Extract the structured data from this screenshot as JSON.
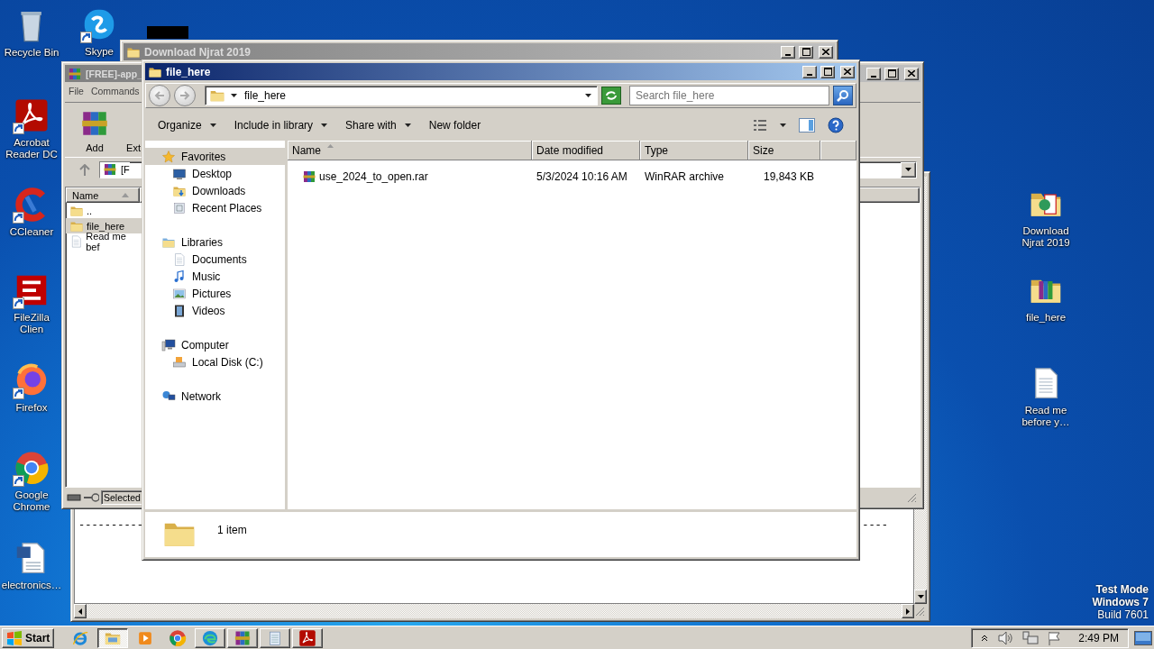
{
  "desktop_icons": [
    {
      "label": "Recycle Bin",
      "kind": "recycle",
      "shortcut": false
    },
    {
      "label": "Skype",
      "kind": "skype",
      "shortcut": true
    },
    {
      "label": "Acrobat Reader DC",
      "kind": "acrobat",
      "shortcut": true
    },
    {
      "label": "CCleaner",
      "kind": "ccleaner",
      "shortcut": true
    },
    {
      "label": "FileZilla Clien",
      "kind": "filezilla",
      "shortcut": true
    },
    {
      "label": "Firefox",
      "kind": "firefox",
      "shortcut": true
    },
    {
      "label": "Google Chrome",
      "kind": "chrome",
      "shortcut": true
    },
    {
      "label": "electronics…",
      "kind": "word",
      "shortcut": false
    },
    {
      "label": "Download Njrat 2019",
      "kind": "njfolder",
      "shortcut": false
    },
    {
      "label": "file_here",
      "kind": "rarfolder",
      "shortcut": false
    },
    {
      "label": "Read me before y…",
      "kind": "text",
      "shortcut": false
    }
  ],
  "text_window": {
    "lines": [
      "----------",
      "----"
    ]
  },
  "njrat_window": {
    "title": "Download Njrat 2019",
    "active": false
  },
  "winrar_window": {
    "title": "[FREE]-app_",
    "active": false,
    "menu": [
      "File",
      "Commands"
    ],
    "tools": [
      {
        "label": "Add",
        "kind": "archive"
      },
      {
        "label": "Ext",
        "kind": "none"
      }
    ],
    "path": "[F",
    "column": "Name",
    "files": [
      {
        "name": "..",
        "kind": "folder",
        "selected": false
      },
      {
        "name": "file_here",
        "kind": "folder",
        "selected": true
      },
      {
        "name": "Read me bef",
        "kind": "text",
        "selected": false
      }
    ],
    "status": "Selected"
  },
  "explorer_window": {
    "title": "file_here",
    "active": true,
    "breadcrumb": "file_here",
    "search": {
      "placeholder": "Search file_here"
    },
    "commands": [
      {
        "label": "Organize",
        "dropdown": true
      },
      {
        "label": "Include in library",
        "dropdown": true
      },
      {
        "label": "Share with",
        "dropdown": true
      },
      {
        "label": "New folder",
        "dropdown": false
      }
    ],
    "nav": [
      {
        "label": "Favorites",
        "kind": "star",
        "selected": true,
        "children": [
          {
            "label": "Desktop",
            "kind": "desktop",
            "selected": false
          },
          {
            "label": "Downloads",
            "kind": "downloads",
            "selected": false
          },
          {
            "label": "Recent Places",
            "kind": "recent",
            "selected": false
          }
        ]
      },
      {
        "label": "Libraries",
        "kind": "library",
        "selected": false,
        "children": [
          {
            "label": "Documents",
            "kind": "documents",
            "selected": false
          },
          {
            "label": "Music",
            "kind": "music",
            "selected": false
          },
          {
            "label": "Pictures",
            "kind": "pictures",
            "selected": false
          },
          {
            "label": "Videos",
            "kind": "videos",
            "selected": false
          }
        ]
      },
      {
        "label": "Computer",
        "kind": "computer",
        "selected": false,
        "children": [
          {
            "label": "Local Disk (C:)",
            "kind": "disk",
            "selected": false
          }
        ]
      },
      {
        "label": "Network",
        "kind": "network",
        "selected": false
      }
    ],
    "columns": [
      {
        "label": "Name",
        "sorted": true
      },
      {
        "label": "Date modified",
        "sorted": false
      },
      {
        "label": "Type",
        "sorted": false
      },
      {
        "label": "Size",
        "sorted": false
      }
    ],
    "files": [
      {
        "name": "use_2024_to_open.rar",
        "kind": "rar",
        "date": "5/3/2024 10:16 AM",
        "type": "WinRAR archive",
        "size": "19,843 KB",
        "selected": false
      }
    ],
    "details": "1 item"
  },
  "taskbar": {
    "start": "Start",
    "apps": [
      {
        "kind": "ie",
        "running": false,
        "selected": false
      },
      {
        "kind": "explorer",
        "running": true,
        "selected": true
      },
      {
        "kind": "wmp",
        "running": false,
        "selected": false
      },
      {
        "kind": "chrome",
        "running": false,
        "selected": false
      },
      {
        "kind": "edge",
        "running": true,
        "selected": false
      },
      {
        "kind": "winrar",
        "running": true,
        "selected": false
      },
      {
        "kind": "notepad",
        "running": true,
        "selected": false
      },
      {
        "kind": "acrobat",
        "running": true,
        "selected": false
      }
    ],
    "clock": "2:49 PM"
  },
  "test_mode_notice": [
    "Test Mode",
    "Windows 7",
    "Build 7601"
  ]
}
